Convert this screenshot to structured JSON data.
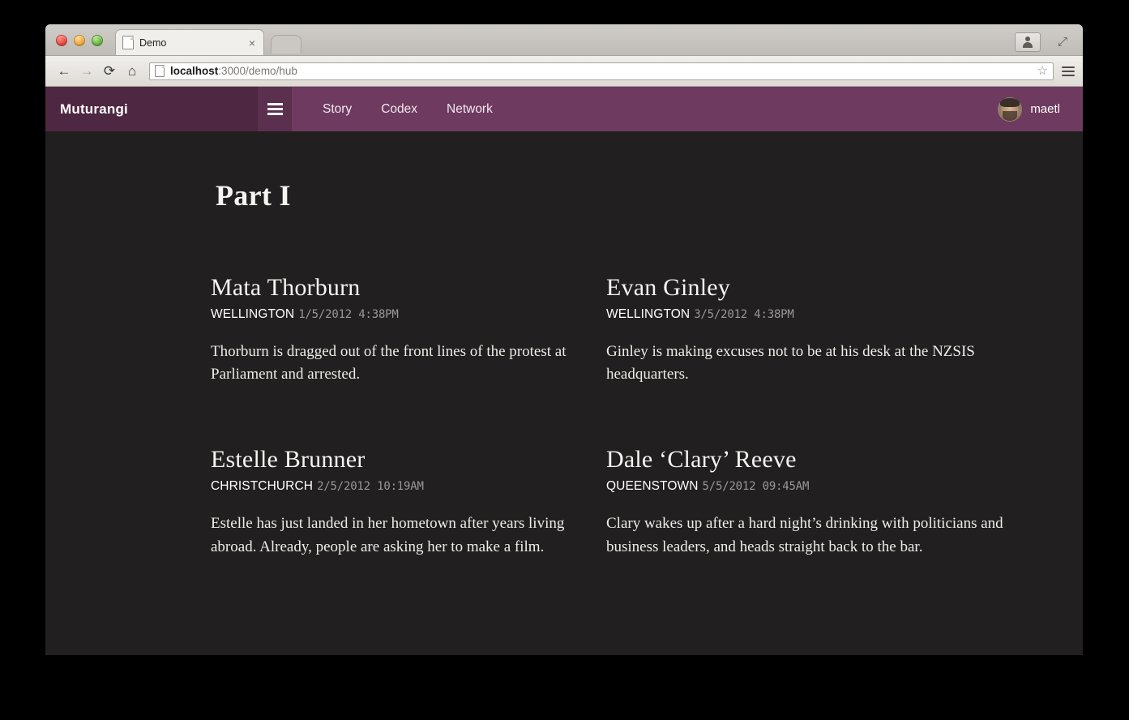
{
  "browser": {
    "tab": {
      "title": "Demo",
      "favicon_icon": "page-icon",
      "close_icon": "close-icon"
    },
    "new_tab_icon": "new-tab-button",
    "window_controls": {
      "close_icon": "close-window-icon",
      "minimize_icon": "minimize-window-icon",
      "zoom_icon": "zoom-window-icon"
    },
    "toolbar": {
      "back_icon": "←",
      "forward_icon": "→",
      "reload_icon": "⟳",
      "home_icon": "⌂",
      "url_host": "localhost",
      "url_rest": ":3000/demo/hub",
      "star_icon": "☆",
      "menu_icon": "hamburger-menu-icon",
      "profile_icon": "profile-icon",
      "expand_icon": "⤢"
    }
  },
  "app": {
    "brand": "Muturangi",
    "nav_toggle_icon": "hamburger-menu-icon",
    "nav_links": [
      {
        "label": "Story"
      },
      {
        "label": "Codex"
      },
      {
        "label": "Network"
      }
    ],
    "user": {
      "name": "maetl",
      "avatar_icon": "user-avatar"
    },
    "colors": {
      "brand_bg": "#4e2742",
      "nav_bg": "#6e3a5f",
      "toggle_bg": "#5b2f4e",
      "page_bg": "#211f1f",
      "text": "#f7f5f3",
      "meta_time": "#9b9897"
    }
  },
  "page": {
    "part_title": "Part I",
    "cards": [
      {
        "name": "Mata Thorburn",
        "place": "WELLINGTON",
        "time": "1/5/2012  4:38PM",
        "body": "Thorburn is dragged out of the front lines of the protest at Parliament and arrested."
      },
      {
        "name": "Evan Ginley",
        "place": "WELLINGTON",
        "time": "3/5/2012  4:38PM",
        "body": "Ginley is making excuses not to be at his desk at the NZSIS headquarters."
      },
      {
        "name": "Estelle Brunner",
        "place": "CHRISTCHURCH",
        "time": "2/5/2012  10:19AM",
        "body": "Estelle has just landed in her hometown after years living abroad. Already, people are asking her to make a film."
      },
      {
        "name": "Dale ‘Clary’ Reeve",
        "place": "QUEENSTOWN",
        "time": "5/5/2012  09:45AM",
        "body": "Clary wakes up after a hard night’s drinking with politicians and business leaders, and heads straight back to the bar."
      }
    ]
  }
}
